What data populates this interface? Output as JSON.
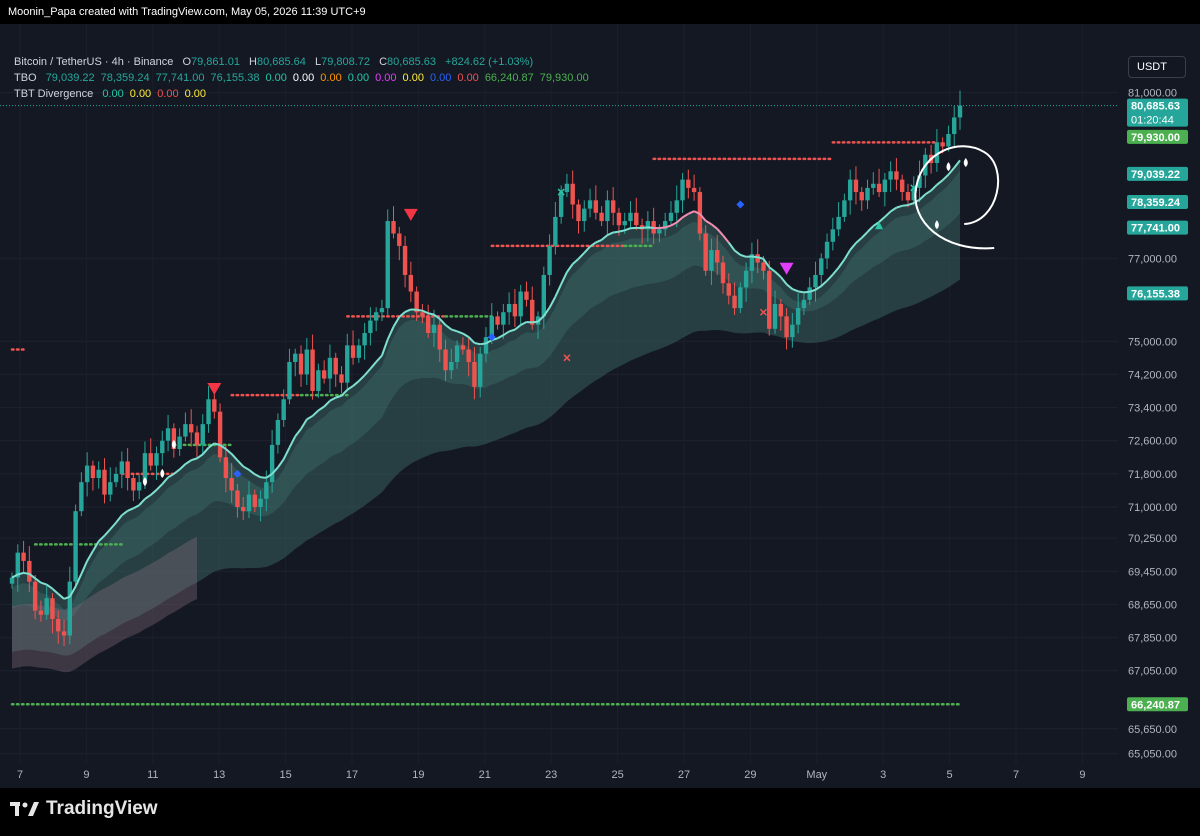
{
  "header": {
    "title": "Moonin_Papa created with TradingView.com, May 05, 2026 11:39 UTC+9"
  },
  "legend": {
    "symbol": "Bitcoin / TetherUS · 4h · Binance",
    "ohlc": {
      "o_label": "O",
      "o": "79,861.01",
      "h_label": "H",
      "h": "80,685.64",
      "l_label": "L",
      "l": "79,808.72",
      "c_label": "C",
      "c": "80,685.63",
      "change": "+824.62 (+1.03%)"
    },
    "tbo": {
      "label": "TBO",
      "values": [
        {
          "v": "79,039.22",
          "color": "#26a69a"
        },
        {
          "v": "78,359.24",
          "color": "#26a69a"
        },
        {
          "v": "77,741.00",
          "color": "#26a69a"
        },
        {
          "v": "76,155.38",
          "color": "#26a69a"
        },
        {
          "v": "0.00",
          "color": "#26c6a6"
        },
        {
          "v": "0.00",
          "color": "#ffffff"
        },
        {
          "v": "0.00",
          "color": "#ff9800"
        },
        {
          "v": "0.00",
          "color": "#26c6a6"
        },
        {
          "v": "0.00",
          "color": "#e040fb"
        },
        {
          "v": "0.00",
          "color": "#ffeb3b"
        },
        {
          "v": "0.00",
          "color": "#2962ff"
        },
        {
          "v": "0.00",
          "color": "#ef5350"
        },
        {
          "v": "66,240.87",
          "color": "#4caf50"
        },
        {
          "v": "79,930.00",
          "color": "#4caf50"
        }
      ]
    },
    "tbt": {
      "label": "TBT Divergence",
      "values": [
        {
          "v": "0.00",
          "color": "#26c6a6"
        },
        {
          "v": "0.00",
          "color": "#ffeb3b"
        },
        {
          "v": "0.00",
          "color": "#ef5350"
        },
        {
          "v": "0.00",
          "color": "#ffeb3b"
        }
      ]
    }
  },
  "currency_button": "USDT",
  "footer": {
    "brand": "TradingView"
  },
  "colors": {
    "up": "#26a69a",
    "down": "#ef5350",
    "ema": "#7ee0d0",
    "band": "#3e6e6a",
    "resistance": "#ef5350",
    "support": "#4caf50"
  },
  "chart_data": {
    "type": "candlestick",
    "timeframe": "4h",
    "ylim": [
      64800,
      81400
    ],
    "y_ticks": [
      "81,000.00",
      "77,000.00",
      "75,000.00",
      "74,200.00",
      "73,400.00",
      "72,600.00",
      "71,800.00",
      "71,000.00",
      "70,250.00",
      "69,450.00",
      "68,650.00",
      "67,850.00",
      "67,050.00",
      "65,650.00",
      "65,050.00"
    ],
    "x_ticks": [
      "7",
      "9",
      "11",
      "13",
      "15",
      "17",
      "19",
      "21",
      "23",
      "25",
      "27",
      "29",
      "May",
      "3",
      "5",
      "7",
      "9"
    ],
    "price_labels": [
      {
        "value": 80685.63,
        "text": "80,685.63",
        "sub": "01:20:44",
        "bg": "#26a69a"
      },
      {
        "value": 79930,
        "text": "79,930.00",
        "bg": "#4caf50"
      },
      {
        "value": 79039.22,
        "text": "79,039.22",
        "bg": "#26a69a"
      },
      {
        "value": 78359.24,
        "text": "78,359.24",
        "bg": "#26a69a"
      },
      {
        "value": 77741,
        "text": "77,741.00",
        "bg": "#26a69a"
      },
      {
        "value": 76155.38,
        "text": "76,155.38",
        "bg": "#26a69a"
      },
      {
        "value": 66240.87,
        "text": "66,240.87",
        "bg": "#4caf50"
      }
    ],
    "close_series": [
      69300,
      69900,
      69700,
      69200,
      68500,
      68400,
      68800,
      68300,
      68000,
      67900,
      69200,
      70900,
      71600,
      72000,
      71700,
      71900,
      71300,
      71600,
      71800,
      72100,
      71700,
      71400,
      71600,
      72300,
      72000,
      72300,
      72600,
      72900,
      72400,
      72700,
      73000,
      72800,
      72500,
      73000,
      73600,
      73300,
      72200,
      71700,
      71400,
      71000,
      70900,
      71300,
      71000,
      71200,
      71600,
      72500,
      73100,
      73600,
      74500,
      74700,
      74200,
      74800,
      73800,
      74300,
      74100,
      74600,
      74200,
      74000,
      74900,
      74600,
      74900,
      75200,
      75500,
      75700,
      75800,
      77900,
      77600,
      77300,
      76600,
      76200,
      75700,
      75600,
      75200,
      75400,
      74800,
      74300,
      74500,
      74900,
      74800,
      74500,
      73900,
      74700,
      75100,
      75600,
      75400,
      75700,
      75900,
      75600,
      76200,
      76000,
      75400,
      75600,
      76600,
      77300,
      78000,
      78600,
      78800,
      78300,
      77900,
      78200,
      78400,
      78100,
      77900,
      78400,
      78100,
      77800,
      77900,
      78100,
      77800,
      77700,
      77900,
      77600,
      77700,
      77900,
      78100,
      78400,
      78900,
      78700,
      78600,
      77600,
      76700,
      77200,
      76900,
      76400,
      76100,
      75800,
      76300,
      76700,
      77100,
      76900,
      76700,
      75300,
      75900,
      75600,
      75100,
      75400,
      75800,
      76000,
      76300,
      76600,
      77000,
      77400,
      77700,
      78000,
      78400,
      78900,
      78600,
      78400,
      78700,
      78800,
      78600,
      78900,
      79100,
      78900,
      78600,
      78400,
      78700,
      79000,
      79500,
      79300,
      79800,
      79700,
      80000,
      80400,
      80685.63
    ],
    "ema_color_change": [
      {
        "from": 112,
        "to": 124,
        "color": "#f48fb1"
      }
    ],
    "horizontal_levels": [
      {
        "value": 66240.87,
        "color": "#4caf50",
        "style": "dotted",
        "from_index": 0,
        "to_index": 164
      },
      {
        "value": 74800,
        "color": "#ef5350",
        "style": "dotted",
        "from_index": 0,
        "to_index": 2
      }
    ],
    "step_levels": [
      {
        "value": 70100,
        "color": "#4caf50",
        "from": 4,
        "to": 19
      },
      {
        "value": 71800,
        "color": "#ef5350",
        "from": 19,
        "to": 28
      },
      {
        "value": 72500,
        "color": "#4caf50",
        "from": 28,
        "to": 38
      },
      {
        "value": 73700,
        "color": "#ef5350",
        "from": 38,
        "to": 50
      },
      {
        "value": 73700,
        "color": "#4caf50",
        "from": 50,
        "to": 58
      },
      {
        "value": 75600,
        "color": "#ef5350",
        "from": 58,
        "to": 75
      },
      {
        "value": 75600,
        "color": "#4caf50",
        "from": 75,
        "to": 83
      },
      {
        "value": 77300,
        "color": "#ef5350",
        "from": 83,
        "to": 106
      },
      {
        "value": 77300,
        "color": "#4caf50",
        "from": 106,
        "to": 111
      },
      {
        "value": 79400,
        "color": "#ef5350",
        "from": 111,
        "to": 142
      },
      {
        "value": 79800,
        "color": "#ef5350",
        "from": 142,
        "to": 160
      }
    ],
    "markers": [
      {
        "i": 69,
        "value": 78000,
        "shape": "tri-down",
        "color": "#f23645"
      },
      {
        "i": 35,
        "value": 73800,
        "shape": "tri-down",
        "color": "#f23645"
      },
      {
        "i": 23,
        "value": 71600,
        "shape": "drop",
        "color": "#ffffff"
      },
      {
        "i": 26,
        "value": 71800,
        "shape": "drop",
        "color": "#ffffff"
      },
      {
        "i": 28,
        "value": 72500,
        "shape": "drop",
        "color": "#ffffff"
      },
      {
        "i": 39,
        "value": 71800,
        "shape": "diamond",
        "color": "#2962ff"
      },
      {
        "i": 83,
        "value": 75100,
        "shape": "diamond",
        "color": "#2962ff"
      },
      {
        "i": 126,
        "value": 78300,
        "shape": "diamond",
        "color": "#2962ff"
      },
      {
        "i": 96,
        "value": 74600,
        "shape": "cross",
        "color": "#ef5350"
      },
      {
        "i": 130,
        "value": 75700,
        "shape": "cross",
        "color": "#ef5350"
      },
      {
        "i": 95,
        "value": 78600,
        "shape": "cross",
        "color": "#26c6a6"
      },
      {
        "i": 156,
        "value": 78700,
        "shape": "cross",
        "color": "#26c6a6"
      },
      {
        "i": 134,
        "value": 76700,
        "shape": "tri-down",
        "color": "#e040fb"
      },
      {
        "i": 150,
        "value": 77800,
        "shape": "tri-up",
        "color": "#26c6a6"
      },
      {
        "i": 160,
        "value": 77800,
        "shape": "drop",
        "color": "#ffffff"
      },
      {
        "i": 162,
        "value": 79200,
        "shape": "drop",
        "color": "#ffffff"
      },
      {
        "i": 165,
        "value": 79300,
        "shape": "drop",
        "color": "#ffffff"
      }
    ],
    "annotation": {
      "shape": "hand-drawn-circle",
      "color": "#ffffff",
      "center_index": 163,
      "value": 78600
    }
  }
}
